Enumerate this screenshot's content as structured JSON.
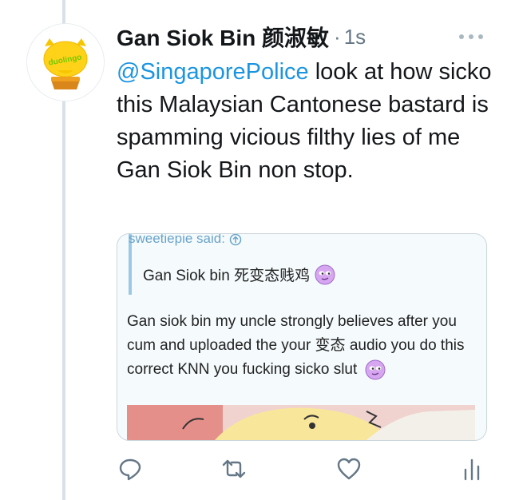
{
  "tweet": {
    "author_name": "Gan Siok Bin 颜淑敏",
    "separator": "·",
    "timestamp": "1s",
    "avatar_logo_text": "duolingo",
    "mention": "@SingaporePolice",
    "text_rest": " look at how sicko this Malaysian Cantonese bastard is spamming vicious filthy lies of me Gan Siok Bin non stop."
  },
  "card": {
    "quote_header": "sweetiepie said:",
    "quote_text": "Gan Siok bin 死变态贱鸡",
    "reply_text": "Gan siok bin my uncle strongly believes after you cum and uploaded the your 变态 audio you do this correct KNN you fucking sicko slut"
  },
  "actions": [
    "reply-icon",
    "retweet-icon",
    "like-icon",
    "analytics-icon"
  ],
  "colors": {
    "link": "#1b95e0",
    "icon": "#657786",
    "thread": "#d9e1e8",
    "accent": "#1da1f2"
  }
}
